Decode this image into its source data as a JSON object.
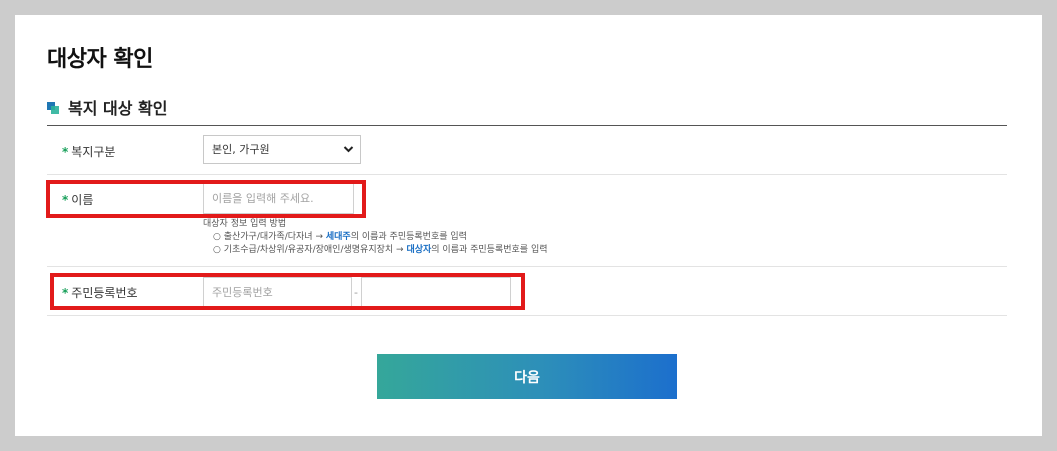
{
  "page": {
    "title": "대상자 확인"
  },
  "section": {
    "title": "복지 대상 확인"
  },
  "form": {
    "required_mark": "*",
    "welfare_type": {
      "label": "복지구분",
      "selected": "본인, 가구원"
    },
    "name": {
      "label": "이름",
      "placeholder": "이름을 입력해 주세요."
    },
    "help": {
      "heading": "대상자 정보 입력 방법",
      "line1": {
        "prefix": "출산가구/대가족/다자녀 → ",
        "highlight": "세대주",
        "suffix": "의 이름과 주민등록번호를 입력"
      },
      "line2": {
        "prefix": "기초수급/차상위/유공자/장애인/생명유지장치 → ",
        "highlight": "대상자",
        "suffix": "의 이름과 주민등록번호를 입력"
      }
    },
    "rrn": {
      "label": "주민등록번호",
      "placeholder_front": "주민등록번호",
      "separator": "-",
      "placeholder_back": ""
    }
  },
  "buttons": {
    "next": "다음"
  },
  "colors": {
    "highlight": "#e21a1a",
    "required": "#18a05a",
    "accent_blue": "#1a6fc4",
    "button_start": "#35a79a",
    "button_end": "#1c6fcd"
  }
}
